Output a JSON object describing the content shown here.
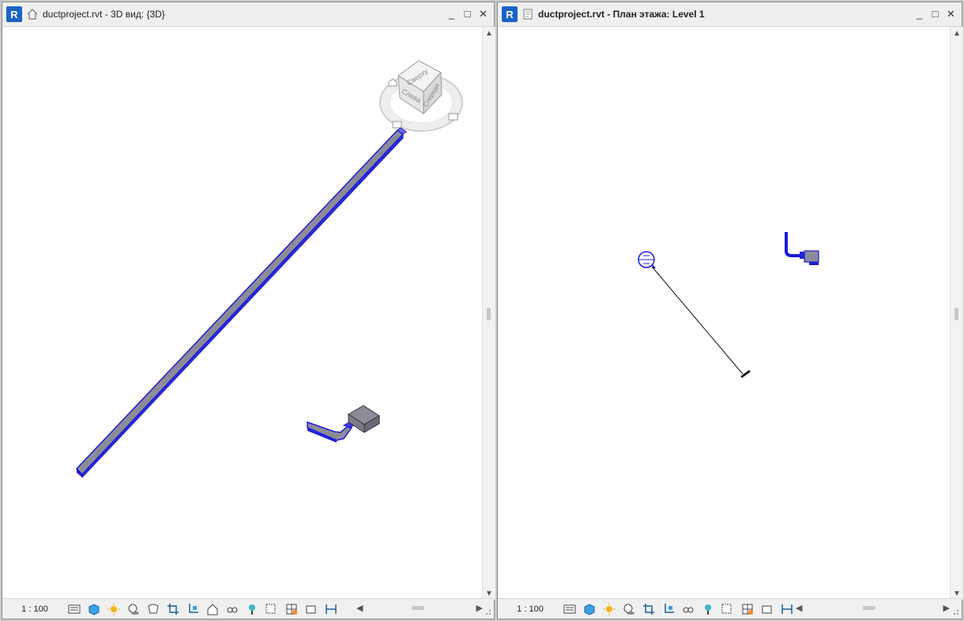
{
  "windows": {
    "left": {
      "app_icon": "R",
      "view_type_icon": "home-3d-view-icon",
      "title": "ductproject.rvt - 3D вид: {3D}",
      "viewcube": {
        "top_face": "Сверху",
        "left_face": "Слева",
        "right_face": "Спереди"
      },
      "scale": "1 : 100",
      "view_bar_icons": [
        "detail-level-icon",
        "visual-style-icon",
        "sun-path-icon",
        "shadows-icon",
        "render-icon",
        "crop-view-icon",
        "show-crop-icon",
        "lock-3d-icon",
        "temporary-hide-icon",
        "reveal-hidden-icon",
        "temporary-view-properties-icon",
        "worksharing-icon",
        "analytical-model-icon",
        "highlight-displacement-icon"
      ]
    },
    "right": {
      "app_icon": "R",
      "view_type_icon": "floor-plan-view-icon",
      "title": "ductproject.rvt - План этажа: Level 1",
      "scale": "1 : 100",
      "view_bar_icons": [
        "detail-level-icon",
        "visual-style-icon",
        "sun-path-icon",
        "shadows-icon",
        "crop-view-icon",
        "show-crop-icon",
        "temporary-hide-icon",
        "reveal-hidden-icon",
        "temporary-view-properties-icon",
        "worksharing-icon",
        "analytical-model-icon",
        "highlight-displacement-icon"
      ]
    }
  },
  "window_controls": {
    "minimize": "_",
    "maximize": "□",
    "close": "✕"
  },
  "colors": {
    "duct_blue": "#1c1cd6",
    "duct_gray": "#8c8c98",
    "app_icon_blue": "#1b63c6"
  }
}
